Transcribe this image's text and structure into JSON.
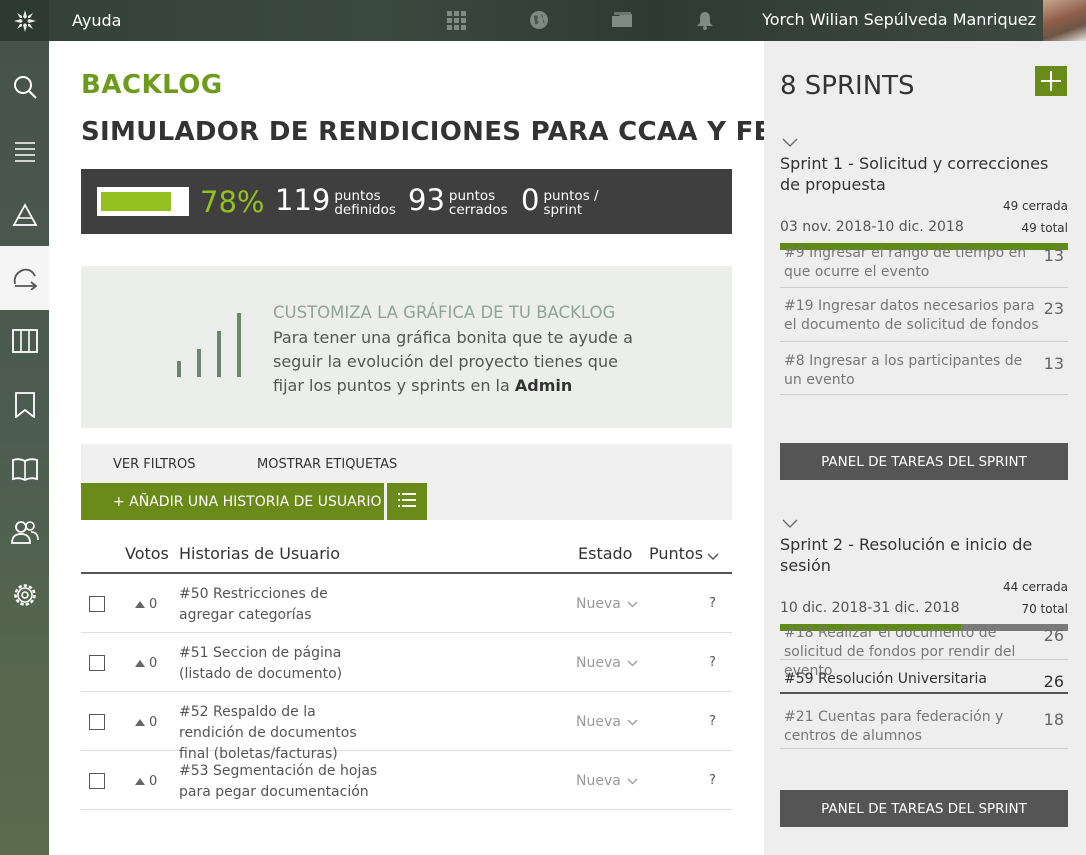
{
  "topbar": {
    "brand": "Ayuda",
    "user_name": "Yorch Wilian Sepúlveda Manriquez",
    "icons": [
      "grid-icon",
      "globe-icon",
      "folder-icon",
      "bell-icon"
    ]
  },
  "sidebar": {
    "items": [
      {
        "name": "search-icon"
      },
      {
        "name": "list-icon"
      },
      {
        "name": "epics-icon"
      },
      {
        "name": "backlog-icon",
        "active": true
      },
      {
        "name": "kanban-icon"
      },
      {
        "name": "bookmark-icon"
      },
      {
        "name": "wiki-icon"
      },
      {
        "name": "team-icon"
      },
      {
        "name": "settings-icon"
      }
    ]
  },
  "backlog": {
    "title": "BACKLOG",
    "project_name": "SIMULADOR DE RENDICIONES PARA CCAA Y FEDEUT",
    "summary": {
      "percent": "78%",
      "progress": 0.78,
      "defined_points": "119",
      "defined_label_1": "puntos",
      "defined_label_2": "definidos",
      "closed_points": "93",
      "closed_label_1": "puntos",
      "closed_label_2": "cerrados",
      "sprint_points": "0",
      "sprint_label_1": "puntos /",
      "sprint_label_2": "sprint"
    },
    "graph": {
      "title": "CUSTOMIZA LA GRÁFICA DE TU BACKLOG",
      "text": "Para tener una gráfica bonita que te ayude a seguir la evolución del proyecto tienes que fijar los puntos y sprints en la ",
      "link": "Admin"
    },
    "toolbar": {
      "filters": "VER FILTROS",
      "tags": "MOSTRAR ETIQUETAS",
      "add_story": "+ AÑADIR UNA HISTORIA DE USUARIO"
    },
    "table": {
      "col_votes": "Votos",
      "col_stories": "Historias de Usuario",
      "col_status": "Estado",
      "col_points": "Puntos",
      "rows": [
        {
          "votes": "0",
          "description": "#50 Restricciones de agregar categorías",
          "status": "Nueva",
          "points": "?"
        },
        {
          "votes": "0",
          "description": "#51 Seccion de página (listado de documento)",
          "status": "Nueva",
          "points": "?"
        },
        {
          "votes": "0",
          "description": "#52 Respaldo de la rendición de documentos final (boletas/facturas)",
          "status": "Nueva",
          "points": "?"
        },
        {
          "votes": "0",
          "description": "#53 Segmentación de hojas para pegar documentación",
          "status": "Nueva",
          "points": "?"
        }
      ]
    }
  },
  "sprints": {
    "heading": "8 SPRINTS",
    "panel_label": "PANEL DE TAREAS DEL SPRINT",
    "list": [
      {
        "name": "Sprint 1 - Solicitud y correcciones de propuesta",
        "closed": "49 cerrada",
        "total": "49 total",
        "dates": "03 nov. 2018-10 dic. 2018",
        "progress": 1.0,
        "stories": [
          {
            "text": "#9 Ingresar el rango de tiempo en que ocurre el evento",
            "points": "13"
          },
          {
            "text": "#19 Ingresar datos necesarios para el documento de solicitud de fondos",
            "points": "23"
          },
          {
            "text": "#8 Ingresar a los participantes de un evento",
            "points": "13"
          }
        ]
      },
      {
        "name": "Sprint 2 - Resolución e inicio de sesión",
        "closed": "44 cerrada",
        "total": "70 total",
        "dates": "10 dic. 2018-31 dic. 2018",
        "progress": 0.63,
        "stories": [
          {
            "text": "#18 Realizar el documento de solicitud de fondos por rendir del evento",
            "points": "26"
          },
          {
            "text": "#59 Resolución Universitaria",
            "points": "26"
          },
          {
            "text": "#21 Cuentas para federación y centros de alumnos",
            "points": "18"
          }
        ]
      }
    ]
  },
  "colors": {
    "accent": "#95c11f",
    "button_green": "#6a8a19",
    "title_green": "#6e9b1d"
  }
}
